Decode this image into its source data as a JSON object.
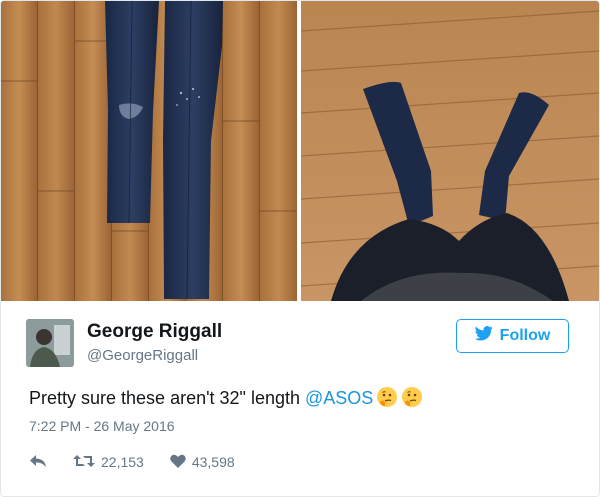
{
  "tweet": {
    "name": "George Riggall",
    "handle": "@GeorgeRiggall",
    "follow_label": "Follow",
    "text": "Pretty sure these aren't 32\" length ",
    "mention": "@ASOS",
    "emoji_icons": [
      "thinking-face-icon",
      "thinking-face-icon"
    ],
    "timestamp": "7:22 PM - 26 May 2016",
    "retweets": "22,153",
    "likes": "43,598"
  },
  "colors": {
    "accent": "#1da1f2",
    "mention": "#1b95e0",
    "muted": "#657786",
    "text": "#14171a",
    "wood": "#b07a45",
    "denim": "#1f2d4a"
  },
  "icons": {
    "follow": "twitter-bird-icon",
    "reply": "reply-arrow-icon",
    "retweet": "retweet-icon",
    "like": "heart-icon"
  }
}
